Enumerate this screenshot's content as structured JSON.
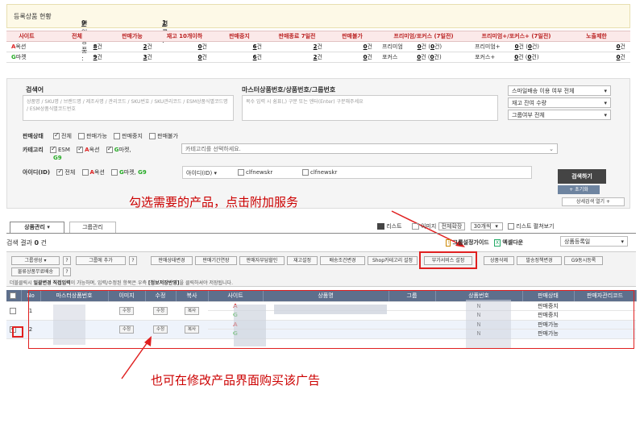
{
  "summary": {
    "title": "등록상품 현황",
    "single_label": "단일상품 :",
    "single_value": "9",
    "single_unit": "건",
    "group_label": "그룹 :",
    "group_value": "1",
    "group_unit": "건"
  },
  "stats": {
    "headers": [
      "사이트",
      "전체",
      "판매가능",
      "재고 10개이하",
      "판매중지",
      "판매종료 7일전",
      "판매불가",
      "프리미엄/포커스 (7일전)",
      "프리미엄+/포커스+ (7일전)",
      "노출제한"
    ],
    "rows": [
      {
        "site_a": "A",
        "site_b": "옥션",
        "total": "8",
        "avail": "2",
        "stock": "0",
        "stop": "6",
        "end7": "2",
        "block": "0",
        "prem_label": "프리미엄",
        "prem": "0",
        "prem7": "0",
        "premp_label": "프리미엄+",
        "premp": "0",
        "premp7": "0",
        "limit": "0"
      },
      {
        "site_a": "G",
        "site_b": "마켓",
        "total": "9",
        "avail": "3",
        "stock": "0",
        "stop": "6",
        "end7": "2",
        "block": "0",
        "prem_label": "포커스",
        "prem": "0",
        "prem7": "0",
        "premp_label": "포커스+",
        "premp": "0",
        "premp7": "0",
        "limit": "0"
      }
    ],
    "unit": "건"
  },
  "search": {
    "keyword_label": "검색어",
    "keyword_placeholder": "상품명 / SKU명 / 브랜드명 / 제조사명 / 관리코드 / SKU번호 / SKU관리코드 / ESM상품식별코드명 / ESM상품식별코드번호",
    "master_label": "마스터상품번호/상품번호/그룹번호",
    "master_placeholder": "복수 입력 시 쉼표(,) 구분 또는 엔터(Enter) 구분해주세요",
    "smile_select": "스마일배송 이용 여부 전체",
    "stock_select": "재고 잔여 수량",
    "group_select": "그룹여부 전체",
    "status_label": "판매상태",
    "status_opts": [
      "전체",
      "판매가능",
      "판매중지",
      "판매불가"
    ],
    "category_label": "카테고리",
    "cat_esm": "ESM",
    "cat_auction_a": "A",
    "cat_auction_b": "옥션",
    "cat_gmarket_a": "G",
    "cat_gmarket_b": "마켓,",
    "cat_g9": "G9",
    "cat_placeholder": "카테고리를 선택하세요.",
    "id_label": "아이디(ID)",
    "id_all": "전체",
    "id_auction_a": "A",
    "id_auction_b": "옥션",
    "id_gmarket_a": "G",
    "id_gmarket_b": "마켓,",
    "id_g9": "G9",
    "id_select": "아이디(ID) ▾",
    "id1": "clfnewskr",
    "id2": "clfnewskr",
    "search_button": "검색하기",
    "reset_button": "+ 초기화",
    "detail_toggle": "상세검색 열기 +"
  },
  "annotations": {
    "top": "勾选需要的产品，点击附加服务",
    "bottom": "也可在修改产品界面购买该广告"
  },
  "tabs": {
    "product": "상품관리 ▾",
    "group": "그룹관리"
  },
  "view": {
    "list": "리스트",
    "image": "이미지",
    "expand": "전체확장",
    "count": "30개씩",
    "list_toggle": "리스트 펼쳐보기"
  },
  "result": {
    "label": "검색 결과",
    "count": "0",
    "unit": "건"
  },
  "toolbar": {
    "group_guide": "그룹설정가이드",
    "excel": "엑셀다운",
    "sort": "상품등록일",
    "buttons1": [
      "그룹생성 ▾",
      "그룹에 추가",
      "판매상태변경",
      "판매기간연장",
      "판매자부담할인",
      "재고설정",
      "배송조건변경",
      "Shop카테고리 설정",
      "부가서비스 설정",
      "상품삭제",
      "발송정책변경",
      "G9동시등록"
    ],
    "button2": "물류상품무료배송"
  },
  "hint": {
    "text1": "더블클릭시",
    "batch": "일괄변경",
    "direct": "직접입력",
    "text2": "이 가능하며, 입력/수정된 항목은 우측",
    "apply": "[정보저장반영]",
    "text3": "을 클릭하셔야 저장됩니다."
  },
  "list": {
    "headers": [
      "No",
      "마스터상품번호",
      "이미지",
      "수정",
      "복사",
      "사이트",
      "상품명",
      "그룹",
      "상품번호",
      "판매상태",
      "판매자관리코드"
    ],
    "rows": [
      {
        "no": "1",
        "edit": "수정",
        "edit2": "수정",
        "copy": "복사",
        "site_a": "A",
        "site_g": "G",
        "group_a": "N",
        "group_b": "N",
        "status_a": "판매중지",
        "status_b": "판매중지"
      },
      {
        "no": "2",
        "edit": "수정",
        "edit2": "수정",
        "copy": "복사",
        "site_a": "A",
        "site_g": "G",
        "group_a": "N",
        "group_b": "N",
        "status_a": "판매가능",
        "status_b": "판매가능"
      }
    ]
  }
}
